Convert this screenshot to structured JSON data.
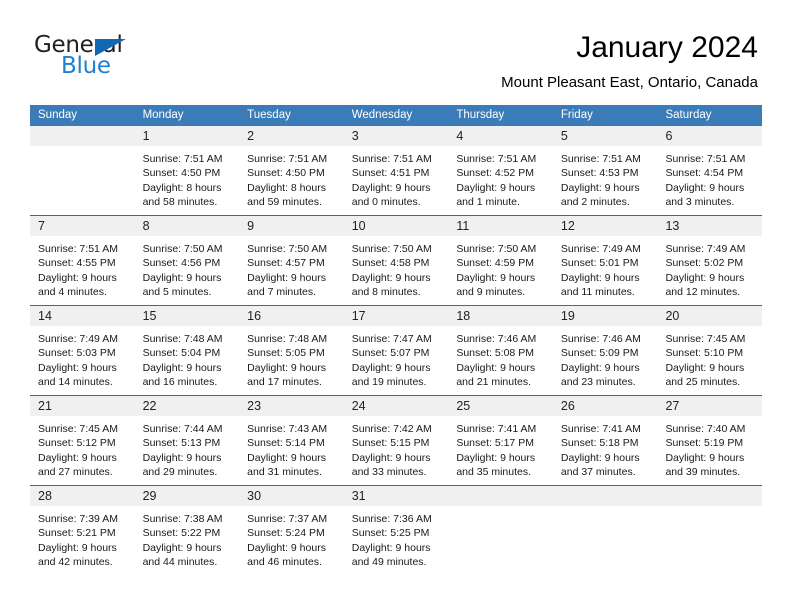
{
  "brand": {
    "name_primary": "General",
    "name_secondary": "Blue",
    "triangle_color": "#1268b3",
    "blue_text_color": "#1f7fd0"
  },
  "header": {
    "title": "January 2024",
    "subtitle": "Mount Pleasant East, Ontario, Canada"
  },
  "theme": {
    "header_row_bg": "#3b7cb8",
    "week_divider": "#2f6fa8",
    "day_number_band_bg": "#f0f0f0"
  },
  "weekdays": [
    "Sunday",
    "Monday",
    "Tuesday",
    "Wednesday",
    "Thursday",
    "Friday",
    "Saturday"
  ],
  "weeks": [
    [
      {
        "day": "",
        "empty": true,
        "sunrise": "",
        "sunset": "",
        "daylight1": "",
        "daylight2": ""
      },
      {
        "day": "1",
        "sunrise": "Sunrise: 7:51 AM",
        "sunset": "Sunset: 4:50 PM",
        "daylight1": "Daylight: 8 hours",
        "daylight2": "and 58 minutes."
      },
      {
        "day": "2",
        "sunrise": "Sunrise: 7:51 AM",
        "sunset": "Sunset: 4:50 PM",
        "daylight1": "Daylight: 8 hours",
        "daylight2": "and 59 minutes."
      },
      {
        "day": "3",
        "sunrise": "Sunrise: 7:51 AM",
        "sunset": "Sunset: 4:51 PM",
        "daylight1": "Daylight: 9 hours",
        "daylight2": "and 0 minutes."
      },
      {
        "day": "4",
        "sunrise": "Sunrise: 7:51 AM",
        "sunset": "Sunset: 4:52 PM",
        "daylight1": "Daylight: 9 hours",
        "daylight2": "and 1 minute."
      },
      {
        "day": "5",
        "sunrise": "Sunrise: 7:51 AM",
        "sunset": "Sunset: 4:53 PM",
        "daylight1": "Daylight: 9 hours",
        "daylight2": "and 2 minutes."
      },
      {
        "day": "6",
        "sunrise": "Sunrise: 7:51 AM",
        "sunset": "Sunset: 4:54 PM",
        "daylight1": "Daylight: 9 hours",
        "daylight2": "and 3 minutes."
      }
    ],
    [
      {
        "day": "7",
        "sunrise": "Sunrise: 7:51 AM",
        "sunset": "Sunset: 4:55 PM",
        "daylight1": "Daylight: 9 hours",
        "daylight2": "and 4 minutes."
      },
      {
        "day": "8",
        "sunrise": "Sunrise: 7:50 AM",
        "sunset": "Sunset: 4:56 PM",
        "daylight1": "Daylight: 9 hours",
        "daylight2": "and 5 minutes."
      },
      {
        "day": "9",
        "sunrise": "Sunrise: 7:50 AM",
        "sunset": "Sunset: 4:57 PM",
        "daylight1": "Daylight: 9 hours",
        "daylight2": "and 7 minutes."
      },
      {
        "day": "10",
        "sunrise": "Sunrise: 7:50 AM",
        "sunset": "Sunset: 4:58 PM",
        "daylight1": "Daylight: 9 hours",
        "daylight2": "and 8 minutes."
      },
      {
        "day": "11",
        "sunrise": "Sunrise: 7:50 AM",
        "sunset": "Sunset: 4:59 PM",
        "daylight1": "Daylight: 9 hours",
        "daylight2": "and 9 minutes."
      },
      {
        "day": "12",
        "sunrise": "Sunrise: 7:49 AM",
        "sunset": "Sunset: 5:01 PM",
        "daylight1": "Daylight: 9 hours",
        "daylight2": "and 11 minutes."
      },
      {
        "day": "13",
        "sunrise": "Sunrise: 7:49 AM",
        "sunset": "Sunset: 5:02 PM",
        "daylight1": "Daylight: 9 hours",
        "daylight2": "and 12 minutes."
      }
    ],
    [
      {
        "day": "14",
        "sunrise": "Sunrise: 7:49 AM",
        "sunset": "Sunset: 5:03 PM",
        "daylight1": "Daylight: 9 hours",
        "daylight2": "and 14 minutes."
      },
      {
        "day": "15",
        "sunrise": "Sunrise: 7:48 AM",
        "sunset": "Sunset: 5:04 PM",
        "daylight1": "Daylight: 9 hours",
        "daylight2": "and 16 minutes."
      },
      {
        "day": "16",
        "sunrise": "Sunrise: 7:48 AM",
        "sunset": "Sunset: 5:05 PM",
        "daylight1": "Daylight: 9 hours",
        "daylight2": "and 17 minutes."
      },
      {
        "day": "17",
        "sunrise": "Sunrise: 7:47 AM",
        "sunset": "Sunset: 5:07 PM",
        "daylight1": "Daylight: 9 hours",
        "daylight2": "and 19 minutes."
      },
      {
        "day": "18",
        "sunrise": "Sunrise: 7:46 AM",
        "sunset": "Sunset: 5:08 PM",
        "daylight1": "Daylight: 9 hours",
        "daylight2": "and 21 minutes."
      },
      {
        "day": "19",
        "sunrise": "Sunrise: 7:46 AM",
        "sunset": "Sunset: 5:09 PM",
        "daylight1": "Daylight: 9 hours",
        "daylight2": "and 23 minutes."
      },
      {
        "day": "20",
        "sunrise": "Sunrise: 7:45 AM",
        "sunset": "Sunset: 5:10 PM",
        "daylight1": "Daylight: 9 hours",
        "daylight2": "and 25 minutes."
      }
    ],
    [
      {
        "day": "21",
        "sunrise": "Sunrise: 7:45 AM",
        "sunset": "Sunset: 5:12 PM",
        "daylight1": "Daylight: 9 hours",
        "daylight2": "and 27 minutes."
      },
      {
        "day": "22",
        "sunrise": "Sunrise: 7:44 AM",
        "sunset": "Sunset: 5:13 PM",
        "daylight1": "Daylight: 9 hours",
        "daylight2": "and 29 minutes."
      },
      {
        "day": "23",
        "sunrise": "Sunrise: 7:43 AM",
        "sunset": "Sunset: 5:14 PM",
        "daylight1": "Daylight: 9 hours",
        "daylight2": "and 31 minutes."
      },
      {
        "day": "24",
        "sunrise": "Sunrise: 7:42 AM",
        "sunset": "Sunset: 5:15 PM",
        "daylight1": "Daylight: 9 hours",
        "daylight2": "and 33 minutes."
      },
      {
        "day": "25",
        "sunrise": "Sunrise: 7:41 AM",
        "sunset": "Sunset: 5:17 PM",
        "daylight1": "Daylight: 9 hours",
        "daylight2": "and 35 minutes."
      },
      {
        "day": "26",
        "sunrise": "Sunrise: 7:41 AM",
        "sunset": "Sunset: 5:18 PM",
        "daylight1": "Daylight: 9 hours",
        "daylight2": "and 37 minutes."
      },
      {
        "day": "27",
        "sunrise": "Sunrise: 7:40 AM",
        "sunset": "Sunset: 5:19 PM",
        "daylight1": "Daylight: 9 hours",
        "daylight2": "and 39 minutes."
      }
    ],
    [
      {
        "day": "28",
        "sunrise": "Sunrise: 7:39 AM",
        "sunset": "Sunset: 5:21 PM",
        "daylight1": "Daylight: 9 hours",
        "daylight2": "and 42 minutes."
      },
      {
        "day": "29",
        "sunrise": "Sunrise: 7:38 AM",
        "sunset": "Sunset: 5:22 PM",
        "daylight1": "Daylight: 9 hours",
        "daylight2": "and 44 minutes."
      },
      {
        "day": "30",
        "sunrise": "Sunrise: 7:37 AM",
        "sunset": "Sunset: 5:24 PM",
        "daylight1": "Daylight: 9 hours",
        "daylight2": "and 46 minutes."
      },
      {
        "day": "31",
        "sunrise": "Sunrise: 7:36 AM",
        "sunset": "Sunset: 5:25 PM",
        "daylight1": "Daylight: 9 hours",
        "daylight2": "and 49 minutes."
      },
      {
        "day": "",
        "empty": true,
        "sunrise": "",
        "sunset": "",
        "daylight1": "",
        "daylight2": ""
      },
      {
        "day": "",
        "empty": true,
        "sunrise": "",
        "sunset": "",
        "daylight1": "",
        "daylight2": ""
      },
      {
        "day": "",
        "empty": true,
        "sunrise": "",
        "sunset": "",
        "daylight1": "",
        "daylight2": ""
      }
    ]
  ]
}
